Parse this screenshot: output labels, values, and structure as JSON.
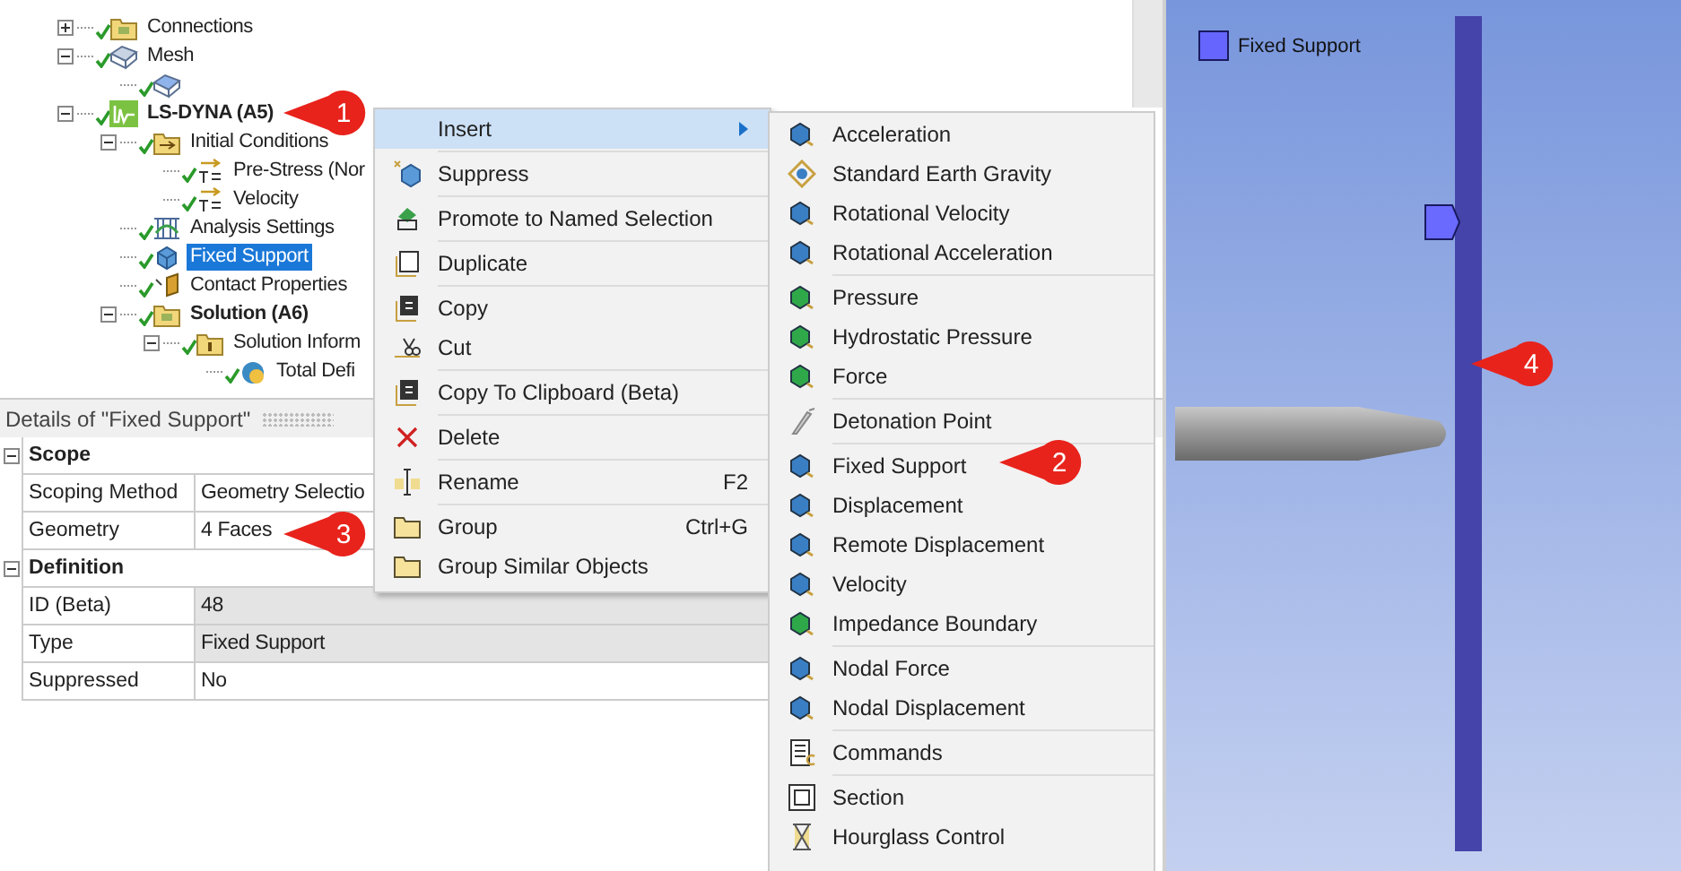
{
  "tree": [
    {
      "label": "Connections",
      "kind": "item",
      "expanded": false,
      "selected": false
    },
    {
      "label": "Mesh",
      "kind": "item",
      "expanded": true,
      "selected": false,
      "children": [
        {
          "selected": false
        }
      ]
    },
    {
      "label": "LS-DYNA (A5)",
      "kind": "analysis",
      "expanded": true,
      "selected": false,
      "children": [
        {
          "label": "Initial Conditions",
          "kind": "item",
          "expanded": true,
          "selected": false,
          "children": [
            {
              "label": "Pre-Stress (Nor",
              "kind": "item",
              "selected": false
            },
            {
              "label": "Velocity",
              "kind": "item",
              "selected": false
            }
          ]
        },
        {
          "label": "Analysis Settings",
          "kind": "item",
          "selected": false
        },
        {
          "label": "Fixed Support",
          "kind": "item",
          "selected": true
        },
        {
          "label": "Contact Properties",
          "kind": "item",
          "selected": false
        },
        {
          "label": "Solution (A6)",
          "kind": "analysis",
          "expanded": true,
          "selected": false,
          "children": [
            {
              "label": "Solution Inform",
              "kind": "item",
              "expanded": true,
              "selected": false,
              "children": [
                {
                  "label": "Total Defi",
                  "kind": "item",
                  "selected": false
                }
              ]
            }
          ]
        }
      ]
    }
  ],
  "details": {
    "title": "Details of \"Fixed Support\"",
    "sections": [
      {
        "label": "Scope",
        "expanded": true,
        "rows": [
          {
            "name": "Scoping Method",
            "value": "Geometry Selectio",
            "readonly": false
          },
          {
            "name": "Geometry",
            "value": "4 Faces",
            "readonly": false
          }
        ]
      },
      {
        "label": "Definition",
        "expanded": true,
        "rows": [
          {
            "name": "ID (Beta)",
            "value": "48",
            "readonly": true
          },
          {
            "name": "Type",
            "value": "Fixed Support",
            "readonly": true
          },
          {
            "name": "Suppressed",
            "value": "No",
            "readonly": false
          }
        ]
      }
    ]
  },
  "context_menu": {
    "groups": [
      [
        {
          "label": "Insert",
          "highlighted": true,
          "submenu": true
        }
      ],
      [
        {
          "label": "Suppress",
          "highlighted": false
        }
      ],
      [
        {
          "label": "Promote to Named Selection",
          "highlighted": false
        }
      ],
      [
        {
          "label": "Duplicate",
          "highlighted": false
        }
      ],
      [
        {
          "label": "Copy",
          "highlighted": false
        },
        {
          "label": "Cut",
          "highlighted": false
        }
      ],
      [
        {
          "label": "Copy To Clipboard (Beta)",
          "highlighted": false
        }
      ],
      [
        {
          "label": "Delete",
          "highlighted": false
        }
      ],
      [
        {
          "label": "Rename",
          "shortcut": "F2",
          "highlighted": false
        }
      ],
      [
        {
          "label": "Group",
          "shortcut": "Ctrl+G",
          "highlighted": false
        },
        {
          "label": "Group Similar Objects",
          "highlighted": false
        }
      ]
    ]
  },
  "insert_submenu": {
    "groups": [
      [
        "Acceleration",
        "Standard Earth Gravity",
        "Rotational Velocity",
        "Rotational Acceleration"
      ],
      [
        "Pressure",
        "Hydrostatic Pressure",
        "Force"
      ],
      [
        "Detonation Point"
      ],
      [
        "Fixed Support",
        "Displacement",
        "Remote Displacement",
        "Velocity",
        "Impedance Boundary"
      ],
      [
        "Nodal Force",
        "Nodal Displacement"
      ],
      [
        "Commands"
      ],
      [
        "Section",
        "Hourglass Control"
      ]
    ]
  },
  "viewport": {
    "legend": "Fixed Support"
  },
  "callouts": [
    "1",
    "2",
    "3",
    "4"
  ]
}
